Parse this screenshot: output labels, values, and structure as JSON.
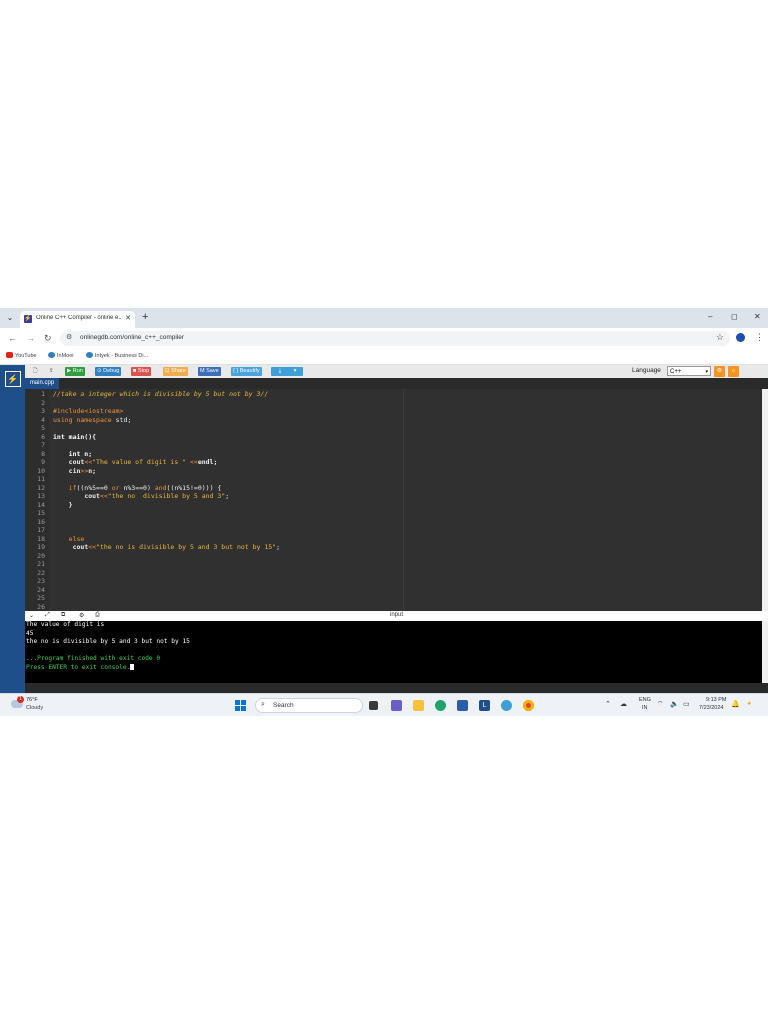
{
  "browser": {
    "tab_title": "Online C++ Compiler - online e...",
    "tab_close": "✕",
    "new_tab": "+",
    "window_controls": {
      "minimize": "–",
      "restore": "◻",
      "close": "✕"
    },
    "url": "onlinegdb.com/online_c++_compiler",
    "bookmarks": [
      "YouTube",
      "InMoei",
      "Intyek - Business Di..."
    ]
  },
  "toolbar": {
    "run": "▶ Run",
    "debug": "⊙ Debug",
    "stop": "■ Stop",
    "share": "⊡ Share",
    "save": "M Save",
    "beautify": "{ } Beautify",
    "download": "⤓",
    "more": "▾",
    "language_label": "Language",
    "language_value": "C++"
  },
  "colors": {
    "sidebar": "#1f4f8a",
    "run": "#2e9e3e",
    "debug": "#2f7fc1",
    "stop": "#d9534f",
    "share": "#f0ad4e",
    "save": "#3a6fb7",
    "beautify": "#4aa3df",
    "download": "#3fa0d8",
    "accent_orange": "#f7931e",
    "console_green": "#39d353"
  },
  "editor": {
    "file_tab": "main.cpp",
    "line_numbers": [
      "1",
      "2",
      "3",
      "4",
      "5",
      "6",
      "7",
      "8",
      "9",
      "10",
      "11",
      "12",
      "13",
      "14",
      "15",
      "16",
      "17",
      "18",
      "19",
      "20",
      "21",
      "22",
      "23",
      "24",
      "25",
      "26"
    ]
  },
  "io": {
    "input_label": "input"
  },
  "console": {
    "lines": [
      "The value of digit is",
      "45",
      "the no is divisible by 5 and 3 but not by 15",
      "",
      "...Program finished with exit code 0",
      "Press ENTER to exit console."
    ]
  },
  "taskbar": {
    "temperature": "76°F",
    "condition": "Cloudy",
    "weather_badge": "1",
    "search_placeholder": "Search",
    "lang_top": "ENG",
    "lang_bottom": "IN",
    "time": "9:13 PM",
    "date": "7/23/2024"
  }
}
